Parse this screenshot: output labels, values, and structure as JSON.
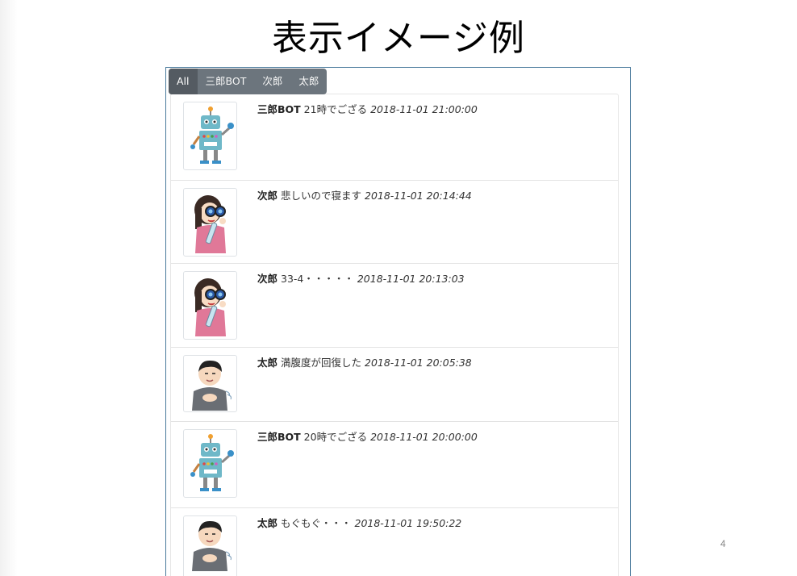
{
  "slide": {
    "title": "表示イメージ例",
    "page_number": "4"
  },
  "tabs": [
    {
      "label": "All",
      "active": true
    },
    {
      "label": "三郎BOT",
      "active": false
    },
    {
      "label": "次郎",
      "active": false
    },
    {
      "label": "太郎",
      "active": false
    }
  ],
  "messages": [
    {
      "name": "三郎BOT",
      "text": "21時でござる",
      "time": "2018-11-01 21:00:00",
      "avatar": "robot-icon"
    },
    {
      "name": "次郎",
      "text": "悲しいので寝ます",
      "time": "2018-11-01 20:14:44",
      "avatar": "binoculars-girl-icon"
    },
    {
      "name": "次郎",
      "text": "33-4・・・・・",
      "time": "2018-11-01 20:13:03",
      "avatar": "binoculars-girl-icon"
    },
    {
      "name": "太郎",
      "text": "満腹度が回復した",
      "time": "2018-11-01 20:05:38",
      "avatar": "boy-icon"
    },
    {
      "name": "三郎BOT",
      "text": "20時でござる",
      "time": "2018-11-01 20:00:00",
      "avatar": "robot-icon"
    },
    {
      "name": "太郎",
      "text": "もぐもぐ・・・",
      "time": "2018-11-01 19:50:22",
      "avatar": "boy-icon"
    }
  ],
  "colors": {
    "tab_bg": "#6c757d",
    "tab_active_bg": "#545b62",
    "frame_border": "#4a7a9c"
  }
}
